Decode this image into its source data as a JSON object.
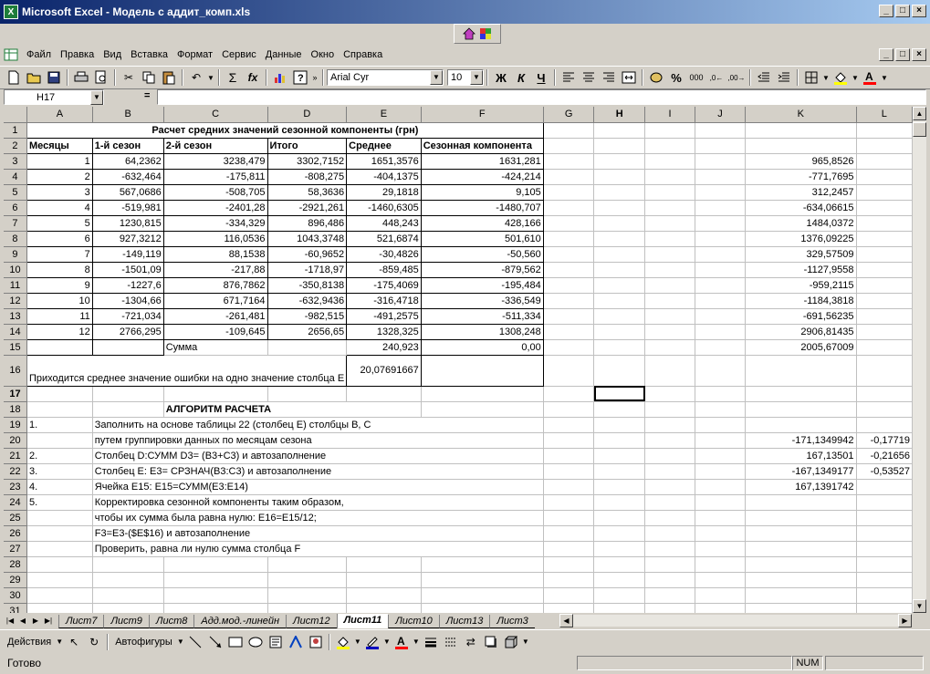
{
  "window": {
    "title": "Microsoft Excel - Модель с аддит_комп.xls",
    "app_icon": "X"
  },
  "menu": [
    "Файл",
    "Правка",
    "Вид",
    "Вставка",
    "Формат",
    "Сервис",
    "Данные",
    "Окно",
    "Справка"
  ],
  "toolbar": {
    "font": "Arial Cyr",
    "size": "10",
    "bold": "Ж",
    "italic": "К",
    "underline": "Ч",
    "percent": "%",
    "thousands": "000",
    "sum": "Σ",
    "fx": "fx"
  },
  "formula": {
    "cell": "H17",
    "eq": "=",
    "value": ""
  },
  "columns": [
    "A",
    "B",
    "C",
    "D",
    "E",
    "F",
    "G",
    "H",
    "I",
    "J",
    "K",
    "L"
  ],
  "title_row": "Расчет средних значений сезонной компоненты (грн)",
  "headers": [
    "Месяцы",
    "1-й сезон",
    "2-й сезон",
    "Итого",
    "Среднее",
    "Сезонная компонента"
  ],
  "rows": [
    [
      "1",
      "64,2362",
      "3238,479",
      "3302,7152",
      "1651,3576",
      "1631,281",
      "965,8526"
    ],
    [
      "2",
      "-632,464",
      "-175,811",
      "-808,275",
      "-404,1375",
      "-424,214",
      "-771,7695"
    ],
    [
      "3",
      "567,0686",
      "-508,705",
      "58,3636",
      "29,1818",
      "9,105",
      "312,2457"
    ],
    [
      "4",
      "-519,981",
      "-2401,28",
      "-2921,261",
      "-1460,6305",
      "-1480,707",
      "-634,06615"
    ],
    [
      "5",
      "1230,815",
      "-334,329",
      "896,486",
      "448,243",
      "428,166",
      "1484,0372"
    ],
    [
      "6",
      "927,3212",
      "116,0536",
      "1043,3748",
      "521,6874",
      "501,610",
      "1376,09225"
    ],
    [
      "7",
      "-149,119",
      "88,1538",
      "-60,9652",
      "-30,4826",
      "-50,560",
      "329,57509"
    ],
    [
      "8",
      "-1501,09",
      "-217,88",
      "-1718,97",
      "-859,485",
      "-879,562",
      "-1127,9558"
    ],
    [
      "9",
      "-1227,6",
      "876,7862",
      "-350,8138",
      "-175,4069",
      "-195,484",
      "-959,2115"
    ],
    [
      "10",
      "-1304,66",
      "671,7164",
      "-632,9436",
      "-316,4718",
      "-336,549",
      "-1184,3818"
    ],
    [
      "11",
      "-721,034",
      "-261,481",
      "-982,515",
      "-491,2575",
      "-511,334",
      "-691,56235"
    ],
    [
      "12",
      "2766,295",
      "-109,645",
      "2656,65",
      "1328,325",
      "1308,248",
      "2906,81435"
    ]
  ],
  "sum_row": {
    "label": "Сумма",
    "e": "240,923",
    "f": "0,00",
    "k": "2005,67009"
  },
  "error_row": {
    "text": "Приходится среднее значение ошибки на одно значение столбца E",
    "e": "20,07691667"
  },
  "algo_title": "АЛГОРИТМ РАСЧЕТА",
  "algo": [
    {
      "a": "1.",
      "b": "Заполнить на основе  таблицы 22 (столбец E) столбцы B, C",
      "k": "",
      "l": ""
    },
    {
      "a": "",
      "b": "путем группировки данных по месяцам сезона",
      "k": "-171,1349942",
      "l": "-0,17719"
    },
    {
      "a": "2.",
      "b": "Столбец D:СУММ D3= (B3+C3) и автозаполнение",
      "k": "167,13501",
      "l": "-0,21656"
    },
    {
      "a": "3.",
      "b": "Столбец E: E3= СРЗНАЧ(B3:C3) и автозаполнение",
      "k": "-167,1349177",
      "l": "-0,53527"
    },
    {
      "a": "4.",
      "b": "Ячейка E15: E15=СУММ(E3:E14)",
      "k": "167,1391742",
      "l": ""
    },
    {
      "a": "5.",
      "b": "Корректировка сезонной компоненты таким образом,",
      "k": "",
      "l": ""
    },
    {
      "a": "",
      "b": "чтобы их сумма была равна нулю: E16=E15/12;",
      "k": "",
      "l": ""
    },
    {
      "a": "",
      "b": "F3=E3-($E$16) и автозаполнение",
      "k": "",
      "l": ""
    },
    {
      "a": "",
      "b": "Проверить, равна ли нулю сумма столбца F",
      "k": "",
      "l": ""
    }
  ],
  "tabs": [
    "Лист7",
    "Лист9",
    "Лист8",
    "Адд.мод.-линейн",
    "Лист12",
    "Лист11",
    "Лист10",
    "Лист13",
    "Лист3"
  ],
  "active_tab": "Лист11",
  "drawbar": {
    "actions": "Действия",
    "autoshapes": "Автофигуры"
  },
  "status": {
    "text": "Готово",
    "num": "NUM"
  }
}
